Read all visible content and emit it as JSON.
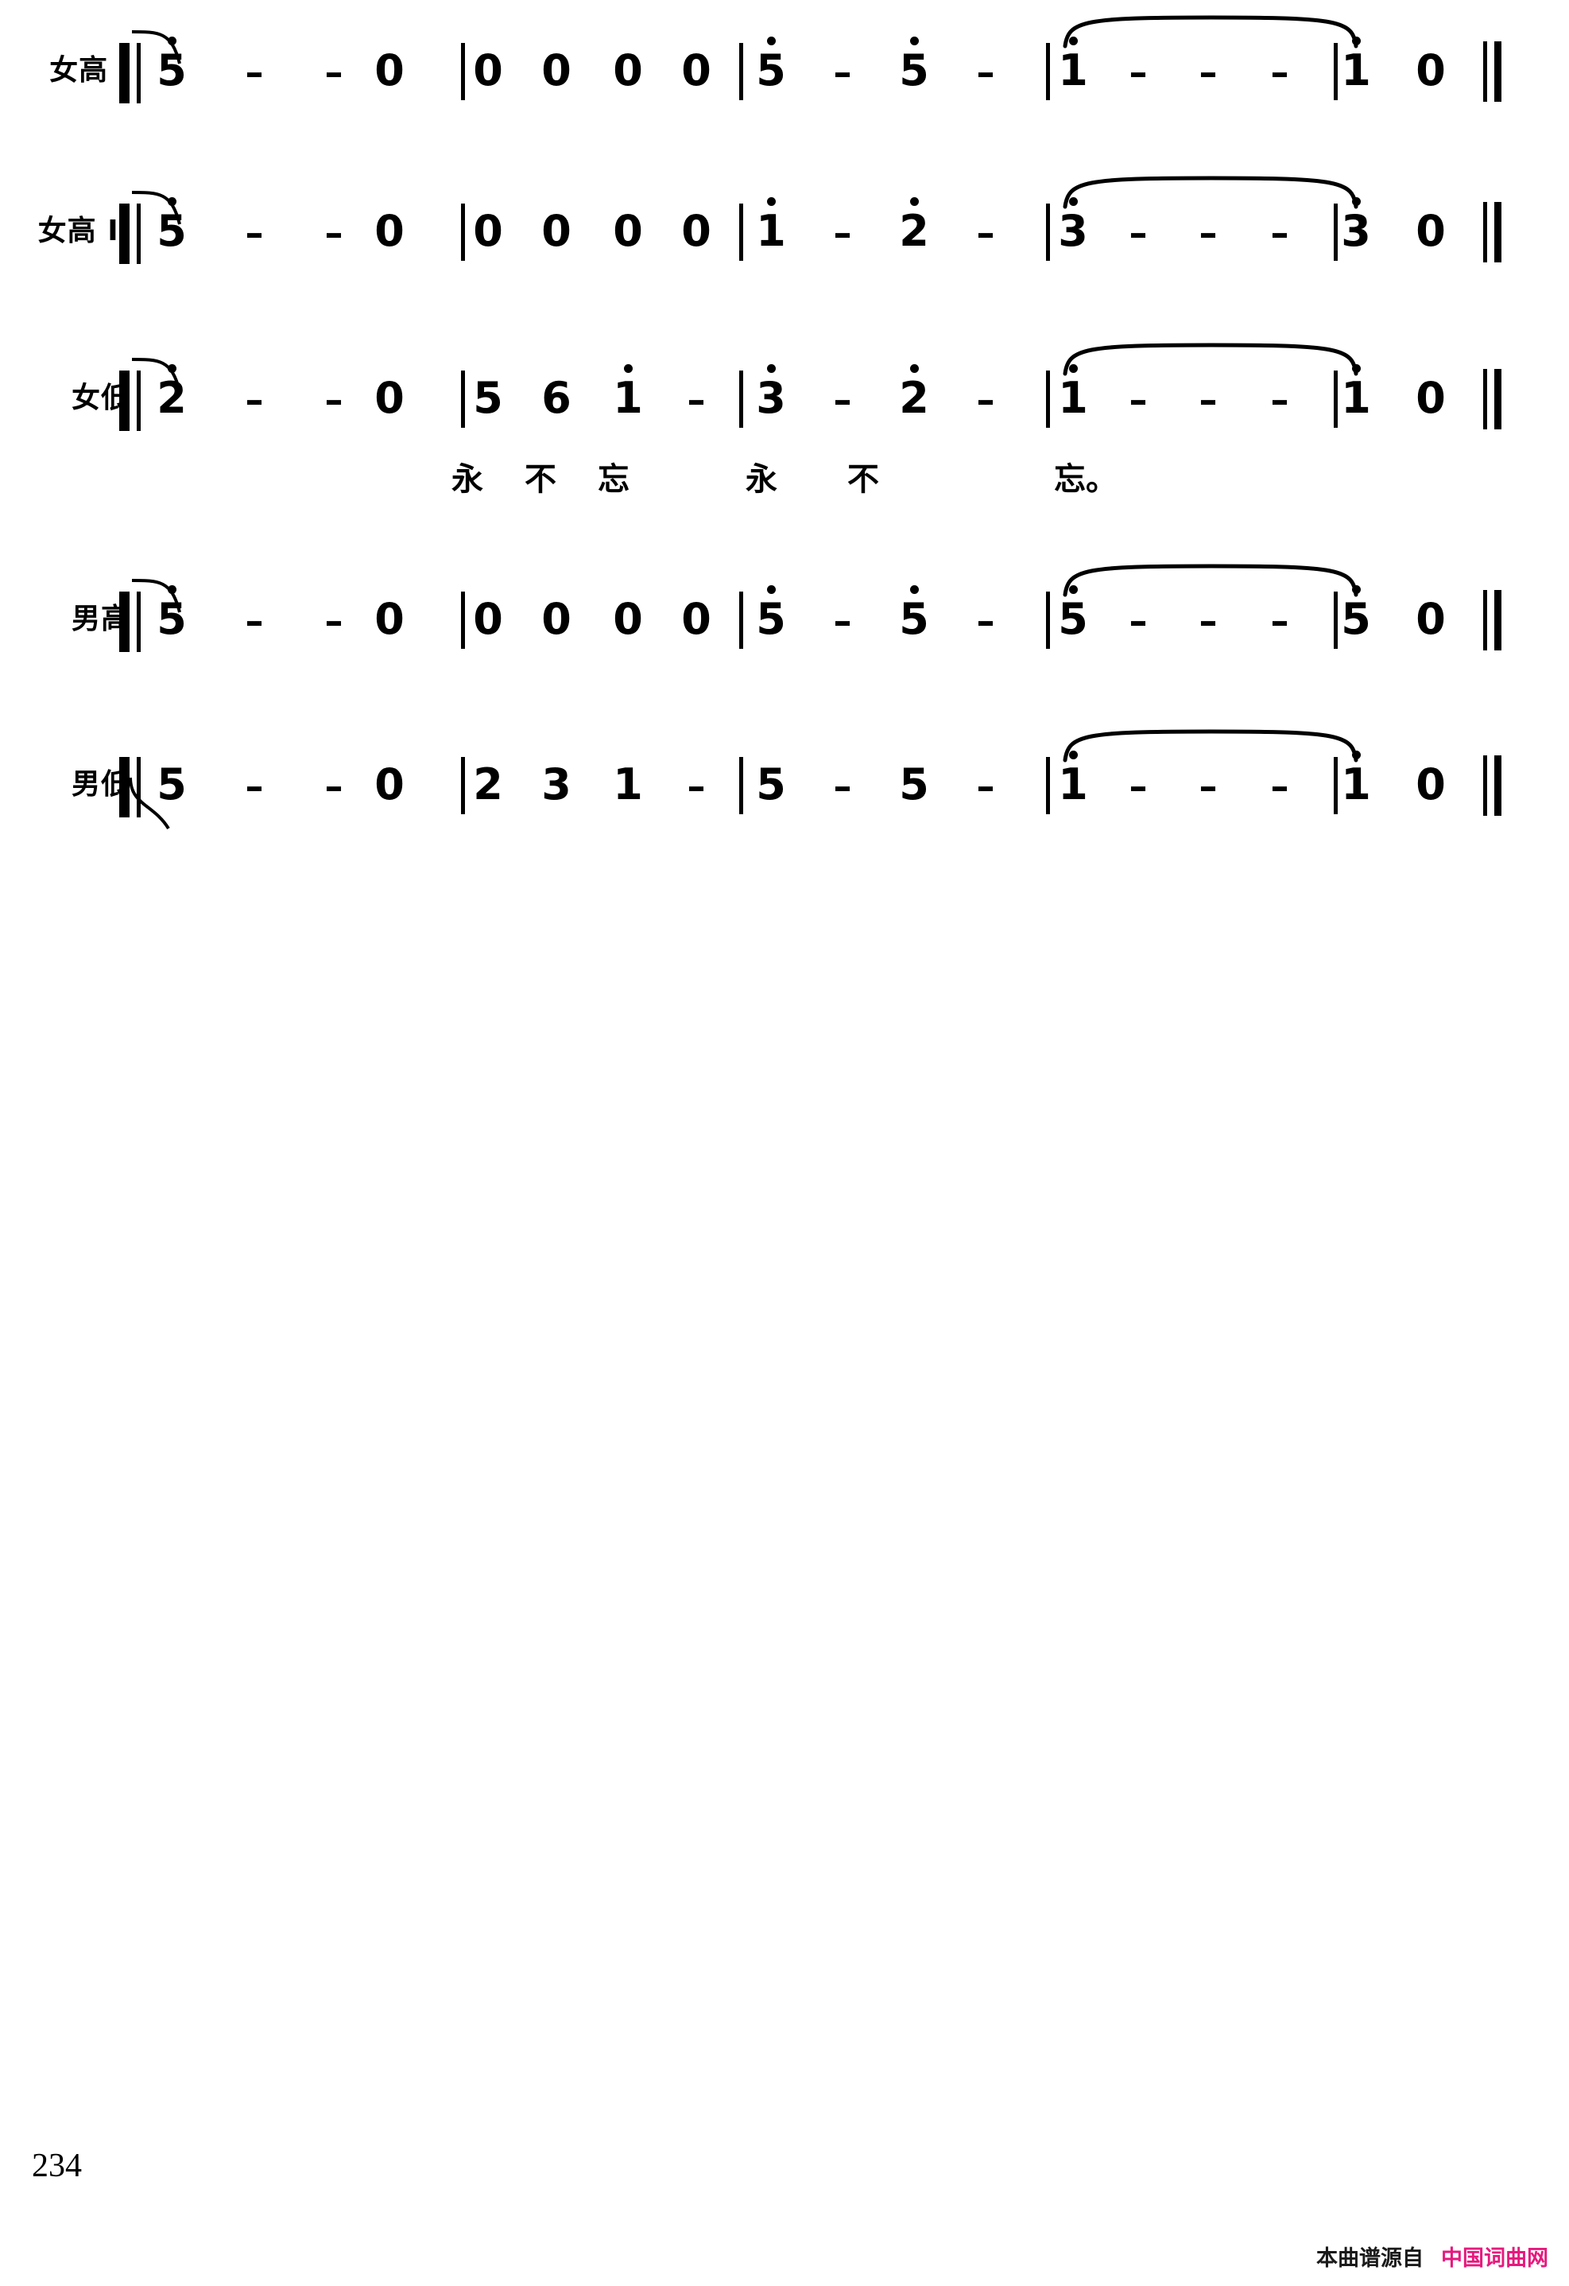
{
  "document": {
    "type": "jianpu-choral-score",
    "page_number": "234",
    "lyrics_text": "永不忘 永不忘。"
  },
  "watermark": {
    "prefix": "本曲谱源自",
    "site": "中国词曲网",
    "site_color": "#e6197e"
  },
  "staves": [
    {
      "label": "女高 I",
      "name": "soprano-1",
      "measures": [
        {
          "notes": [
            {
              "text": "5",
              "octave": "up"
            },
            {
              "text": "–",
              "octave": "none"
            },
            {
              "text": "–",
              "octave": "none"
            },
            {
              "text": "0",
              "octave": "none"
            }
          ]
        },
        {
          "notes": [
            {
              "text": "0",
              "octave": "none"
            },
            {
              "text": "0",
              "octave": "none"
            },
            {
              "text": "0",
              "octave": "none"
            },
            {
              "text": "0",
              "octave": "none"
            }
          ]
        },
        {
          "notes": [
            {
              "text": "5",
              "octave": "up"
            },
            {
              "text": "–",
              "octave": "none"
            },
            {
              "text": "5",
              "octave": "up"
            },
            {
              "text": "–",
              "octave": "none"
            }
          ]
        },
        {
          "notes": [
            {
              "text": "1",
              "octave": "up"
            },
            {
              "text": "–",
              "octave": "none"
            },
            {
              "text": "–",
              "octave": "none"
            },
            {
              "text": "–",
              "octave": "none"
            }
          ]
        },
        {
          "notes": [
            {
              "text": "1",
              "octave": "up"
            },
            {
              "text": "0",
              "octave": "none"
            }
          ]
        }
      ]
    },
    {
      "label": "女高 II",
      "name": "soprano-2",
      "measures": [
        {
          "notes": [
            {
              "text": "5",
              "octave": "up"
            },
            {
              "text": "–",
              "octave": "none"
            },
            {
              "text": "–",
              "octave": "none"
            },
            {
              "text": "0",
              "octave": "none"
            }
          ]
        },
        {
          "notes": [
            {
              "text": "0",
              "octave": "none"
            },
            {
              "text": "0",
              "octave": "none"
            },
            {
              "text": "0",
              "octave": "none"
            },
            {
              "text": "0",
              "octave": "none"
            }
          ]
        },
        {
          "notes": [
            {
              "text": "1",
              "octave": "up"
            },
            {
              "text": "–",
              "octave": "none"
            },
            {
              "text": "2",
              "octave": "up"
            },
            {
              "text": "–",
              "octave": "none"
            }
          ]
        },
        {
          "notes": [
            {
              "text": "3",
              "octave": "up"
            },
            {
              "text": "–",
              "octave": "none"
            },
            {
              "text": "–",
              "octave": "none"
            },
            {
              "text": "–",
              "octave": "none"
            }
          ]
        },
        {
          "notes": [
            {
              "text": "3",
              "octave": "up"
            },
            {
              "text": "0",
              "octave": "none"
            }
          ]
        }
      ]
    },
    {
      "label": "女低",
      "name": "alto",
      "measures": [
        {
          "notes": [
            {
              "text": "2",
              "octave": "up"
            },
            {
              "text": "–",
              "octave": "none"
            },
            {
              "text": "–",
              "octave": "none"
            },
            {
              "text": "0",
              "octave": "none"
            }
          ]
        },
        {
          "notes": [
            {
              "text": "5",
              "octave": "none"
            },
            {
              "text": "6",
              "octave": "none"
            },
            {
              "text": "1",
              "octave": "up"
            },
            {
              "text": "–",
              "octave": "none"
            }
          ]
        },
        {
          "notes": [
            {
              "text": "3",
              "octave": "up"
            },
            {
              "text": "–",
              "octave": "none"
            },
            {
              "text": "2",
              "octave": "up"
            },
            {
              "text": "–",
              "octave": "none"
            }
          ]
        },
        {
          "notes": [
            {
              "text": "1",
              "octave": "up"
            },
            {
              "text": "–",
              "octave": "none"
            },
            {
              "text": "–",
              "octave": "none"
            },
            {
              "text": "–",
              "octave": "none"
            }
          ]
        },
        {
          "notes": [
            {
              "text": "1",
              "octave": "up"
            },
            {
              "text": "0",
              "octave": "none"
            }
          ]
        }
      ]
    },
    {
      "label": "男高",
      "name": "tenor",
      "measures": [
        {
          "notes": [
            {
              "text": "5",
              "octave": "up"
            },
            {
              "text": "–",
              "octave": "none"
            },
            {
              "text": "–",
              "octave": "none"
            },
            {
              "text": "0",
              "octave": "none"
            }
          ]
        },
        {
          "notes": [
            {
              "text": "0",
              "octave": "none"
            },
            {
              "text": "0",
              "octave": "none"
            },
            {
              "text": "0",
              "octave": "none"
            },
            {
              "text": "0",
              "octave": "none"
            }
          ]
        },
        {
          "notes": [
            {
              "text": "5",
              "octave": "up"
            },
            {
              "text": "–",
              "octave": "none"
            },
            {
              "text": "5",
              "octave": "up"
            },
            {
              "text": "–",
              "octave": "none"
            }
          ]
        },
        {
          "notes": [
            {
              "text": "5",
              "octave": "up"
            },
            {
              "text": "–",
              "octave": "none"
            },
            {
              "text": "–",
              "octave": "none"
            },
            {
              "text": "–",
              "octave": "none"
            }
          ]
        },
        {
          "notes": [
            {
              "text": "5",
              "octave": "up"
            },
            {
              "text": "0",
              "octave": "none"
            }
          ]
        }
      ]
    },
    {
      "label": "男低",
      "name": "bass",
      "measures": [
        {
          "notes": [
            {
              "text": "5",
              "octave": "none"
            },
            {
              "text": "–",
              "octave": "none"
            },
            {
              "text": "–",
              "octave": "none"
            },
            {
              "text": "0",
              "octave": "none"
            }
          ]
        },
        {
          "notes": [
            {
              "text": "2",
              "octave": "none"
            },
            {
              "text": "3",
              "octave": "none"
            },
            {
              "text": "1",
              "octave": "none"
            },
            {
              "text": "–",
              "octave": "none"
            }
          ]
        },
        {
          "notes": [
            {
              "text": "5",
              "octave": "none"
            },
            {
              "text": "–",
              "octave": "none"
            },
            {
              "text": "5",
              "octave": "none"
            },
            {
              "text": "–",
              "octave": "none"
            }
          ]
        },
        {
          "notes": [
            {
              "text": "1",
              "octave": "up"
            },
            {
              "text": "–",
              "octave": "none"
            },
            {
              "text": "–",
              "octave": "none"
            },
            {
              "text": "–",
              "octave": "none"
            }
          ]
        },
        {
          "notes": [
            {
              "text": "1",
              "octave": "up"
            },
            {
              "text": "0",
              "octave": "none"
            }
          ]
        }
      ]
    }
  ],
  "lyrics": [
    {
      "text": "永"
    },
    {
      "text": "不"
    },
    {
      "text": "忘"
    },
    {
      "text": "永"
    },
    {
      "text": "不"
    },
    {
      "text": "忘。"
    }
  ]
}
